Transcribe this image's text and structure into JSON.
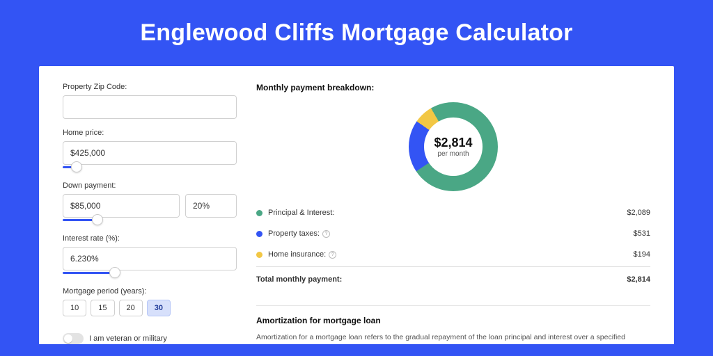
{
  "title": "Englewood Cliffs Mortgage Calculator",
  "inputs": {
    "zip": {
      "label": "Property Zip Code:",
      "value": ""
    },
    "price": {
      "label": "Home price:",
      "value": "$425,000",
      "slider_pct": 8
    },
    "down": {
      "label": "Down payment:",
      "amount": "$85,000",
      "percent": "20%",
      "slider_pct": 20
    },
    "rate": {
      "label": "Interest rate (%):",
      "value": "6.230%",
      "slider_pct": 30
    },
    "period": {
      "label": "Mortgage period (years):",
      "options": [
        "10",
        "15",
        "20",
        "30"
      ],
      "selected": "30"
    },
    "veteran": {
      "label": "I am veteran or military",
      "checked": false
    }
  },
  "breakdown": {
    "title": "Monthly payment breakdown:",
    "center_amount": "$2,814",
    "center_sub": "per month",
    "items": [
      {
        "name": "Principal & Interest:",
        "value": "$2,089",
        "color": "#4aa785",
        "share": 74,
        "info": false
      },
      {
        "name": "Property taxes:",
        "value": "$531",
        "color": "#3354f4",
        "share": 19,
        "info": true
      },
      {
        "name": "Home insurance:",
        "value": "$194",
        "color": "#f2c744",
        "share": 7,
        "info": true
      }
    ],
    "total_label": "Total monthly payment:",
    "total_value": "$2,814"
  },
  "amort": {
    "title": "Amortization for mortgage loan",
    "body": "Amortization for a mortgage loan refers to the gradual repayment of the loan principal and interest over a specified"
  },
  "chart_data": {
    "type": "pie",
    "title": "Monthly payment breakdown",
    "series": [
      {
        "name": "Principal & Interest",
        "value": 2089,
        "color": "#4aa785"
      },
      {
        "name": "Property taxes",
        "value": 531,
        "color": "#3354f4"
      },
      {
        "name": "Home insurance",
        "value": 194,
        "color": "#f2c744"
      }
    ],
    "total": 2814,
    "center_label": "$2,814 per month"
  }
}
